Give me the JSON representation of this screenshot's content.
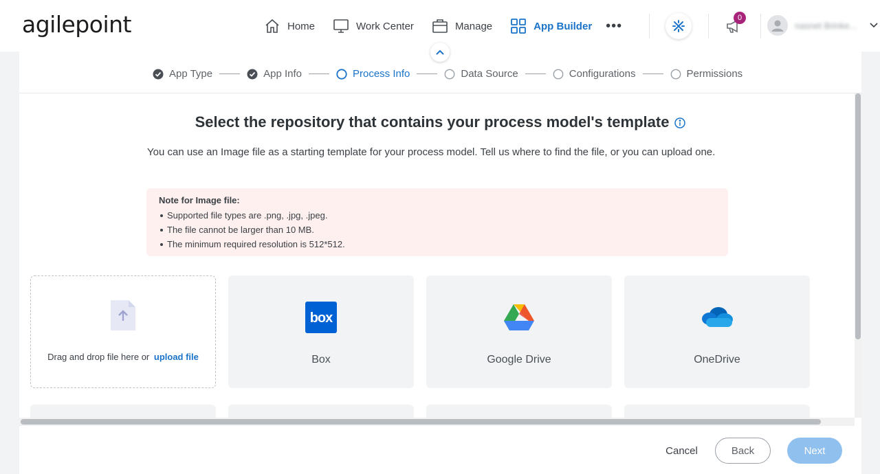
{
  "brand": {
    "logo_text": "agilepoint"
  },
  "nav": {
    "items": [
      {
        "label": "Home",
        "icon": "home-icon"
      },
      {
        "label": "Work Center",
        "icon": "monitor-icon"
      },
      {
        "label": "Manage",
        "icon": "briefcase-icon"
      },
      {
        "label": "App Builder",
        "icon": "grid-icon",
        "active": true
      }
    ],
    "more_label": "•••",
    "notifications_count": "0",
    "user_name": "nasnet Brinke..."
  },
  "stepper": {
    "steps": [
      {
        "label": "App Type",
        "state": "done"
      },
      {
        "label": "App Info",
        "state": "done"
      },
      {
        "label": "Process Info",
        "state": "current"
      },
      {
        "label": "Data Source",
        "state": "pending"
      },
      {
        "label": "Configurations",
        "state": "pending"
      },
      {
        "label": "Permissions",
        "state": "pending"
      }
    ]
  },
  "main": {
    "title": "Select the repository that contains your process model's template",
    "description": "You can use an Image file as a starting template for your process model. Tell us where to find the file, or you can upload one.",
    "note": {
      "title": "Note for Image file:",
      "items": [
        "Supported file types are .png, .jpg, .jpeg.",
        "The file cannot be larger than 10 MB.",
        "The minimum required resolution is 512*512."
      ]
    },
    "upload": {
      "text": "Drag and drop file here or",
      "link": "upload file"
    },
    "repositories": [
      {
        "label": "Box",
        "icon": "box-logo-icon"
      },
      {
        "label": "Google Drive",
        "icon": "google-drive-icon"
      },
      {
        "label": "OneDrive",
        "icon": "onedrive-icon"
      }
    ]
  },
  "footer": {
    "cancel": "Cancel",
    "back": "Back",
    "next": "Next"
  },
  "colors": {
    "accent": "#1a73c8",
    "badge": "#a8247a",
    "note_bg": "#fdf0ee",
    "next_disabled": "#8fc0ee"
  }
}
